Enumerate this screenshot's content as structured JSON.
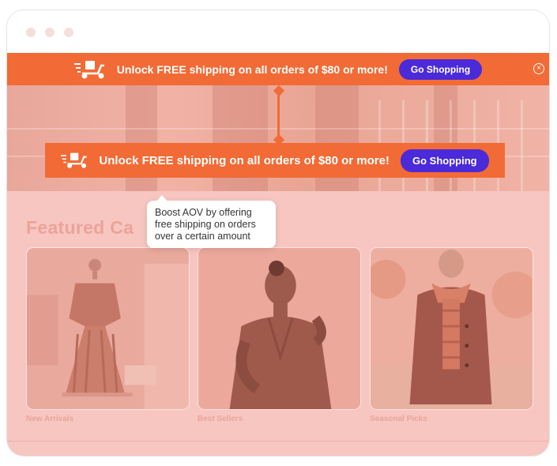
{
  "promo_top": {
    "message": "Unlock FREE shipping on all orders of $80 or more!",
    "button_label": "Go Shopping",
    "close_icon": "×"
  },
  "promo_mid": {
    "message": "Unlock FREE shipping on all orders of $80 or more!",
    "button_label": "Go Shopping"
  },
  "tooltip": {
    "text": "Boost AOV by offering free shipping on orders over a certain amount"
  },
  "section": {
    "title": "Featured Ca"
  },
  "cards": [
    {
      "label": "New Arrivals"
    },
    {
      "label": "Best Sellers"
    },
    {
      "label": "Seasonal Picks"
    }
  ],
  "colors": {
    "accent": "#f26a35",
    "button": "#4a2ad9",
    "overlay": "#f7c6c1"
  }
}
